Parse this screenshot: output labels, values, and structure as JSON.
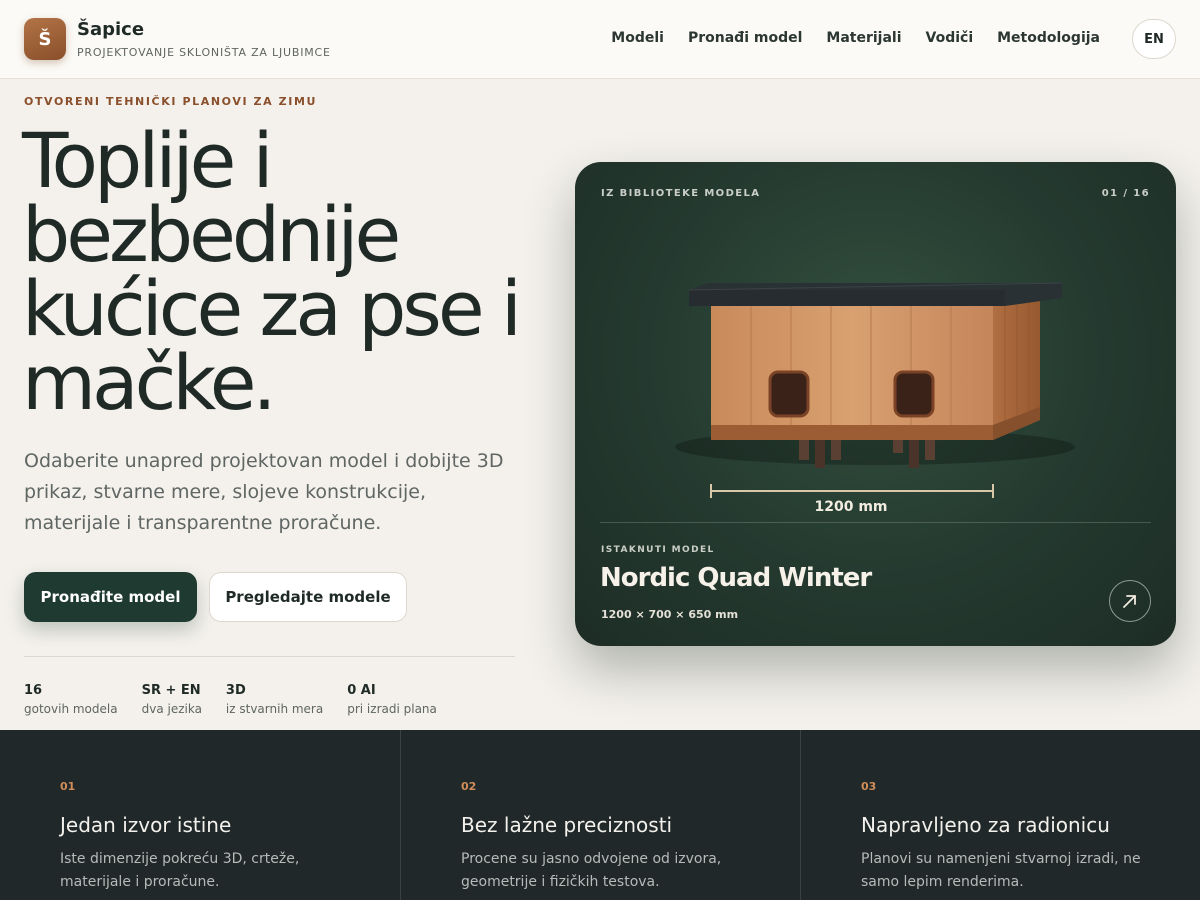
{
  "header": {
    "logo_letter": "Š",
    "brand_name": "Šapice",
    "brand_tagline": "PROJEKTOVANJE SKLONIŠTA ZA LJUBIMCE",
    "nav": [
      "Modeli",
      "Pronađi model",
      "Materijali",
      "Vodiči",
      "Metodologija"
    ],
    "language": "EN"
  },
  "hero": {
    "eyebrow": "OTVORENI TEHNIČKI PLANOVI ZA ZIMU",
    "title": "Toplije i bezbednije kućice za pse i mačke.",
    "description": "Odaberite unapred projektovan model i dobijte 3D prikaz, stvarne mere, slojeve konstrukcije, materijale i transparentne proračune.",
    "primary_button": "Pronađite model",
    "secondary_button": "Pregledajte modele",
    "stats": [
      {
        "value": "16",
        "label": "gotovih modela"
      },
      {
        "value": "SR + EN",
        "label": "dva jezika"
      },
      {
        "value": "3D",
        "label": "iz stvarnih mera"
      },
      {
        "value": "0 AI",
        "label": "pri izradi plana"
      }
    ]
  },
  "card": {
    "eyebrow": "IZ BIBLIOTEKE MODELA",
    "counter": "01 / 16",
    "dimension_label": "1200 mm",
    "kicker": "ISTAKNUTI MODEL",
    "title": "Nordic Quad Winter",
    "dimensions": "1200 × 700 × 650 mm",
    "arrow_icon": "arrow-up-right-icon"
  },
  "features": [
    {
      "number": "01",
      "title": "Jedan izvor istine",
      "description": "Iste dimenzije pokreću 3D, crteže, materijale i proračune."
    },
    {
      "number": "02",
      "title": "Bez lažne preciznosti",
      "description": "Procene su jasno odvojene od izvora, geometrije i fizičkih testova."
    },
    {
      "number": "03",
      "title": "Napravljeno za radionicu",
      "description": "Planovi su namenjeni stvarnoj izradi, ne samo lepim renderima."
    }
  ],
  "colors": {
    "accent": "#8a4f2b",
    "primary_dark": "#1f3a31",
    "band_background": "#21282a",
    "feature_number": "#d08d58"
  }
}
